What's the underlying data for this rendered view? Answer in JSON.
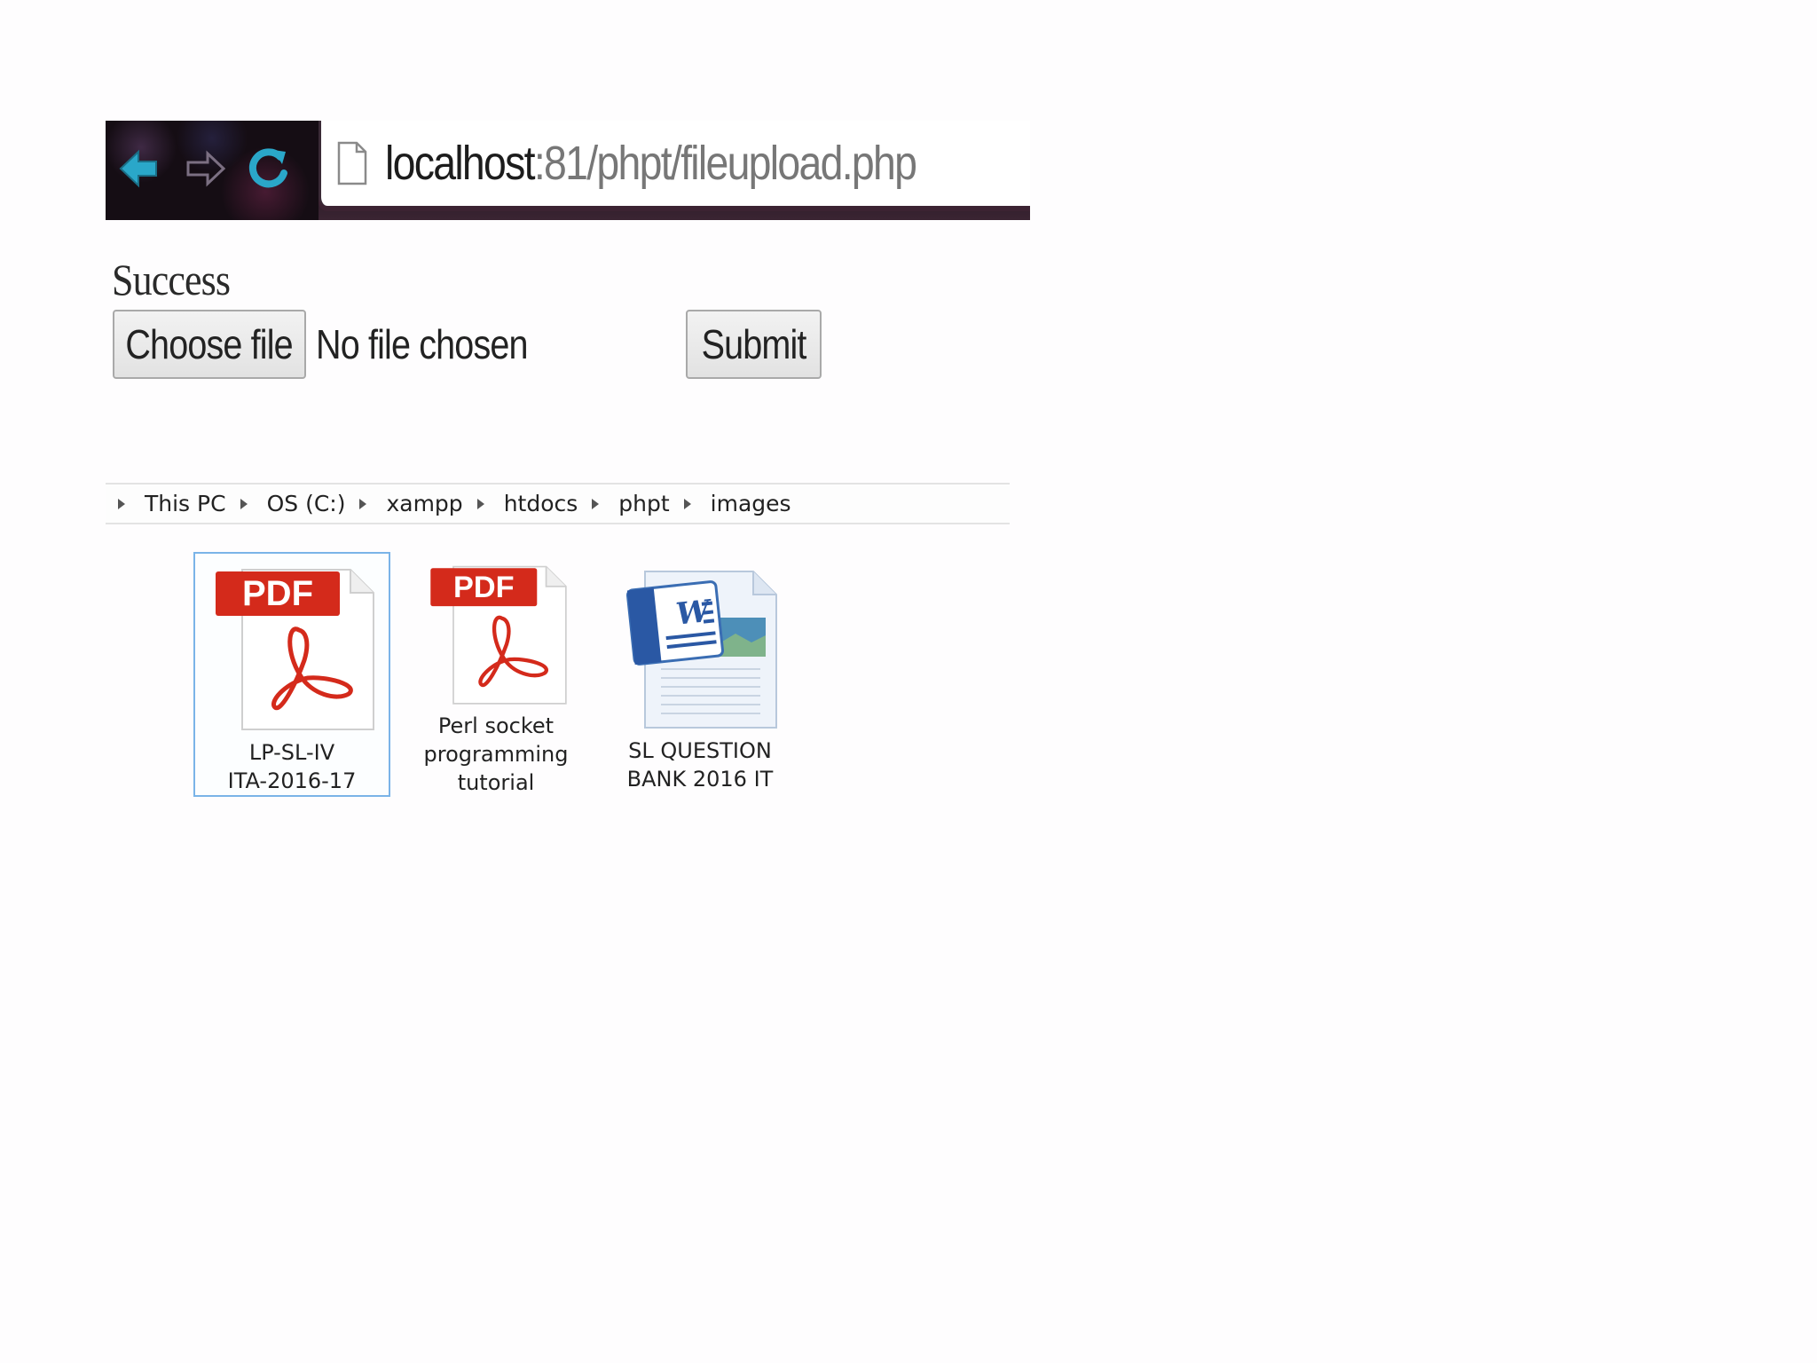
{
  "browser": {
    "url_host": "localhost",
    "url_path": ":81/phpt/fileupload.php",
    "icons": [
      "back-arrow-icon",
      "forward-arrow-icon",
      "reload-icon",
      "page-icon"
    ],
    "accent": "#2aa7c9"
  },
  "form": {
    "status": "Success",
    "choose_label": "Choose file",
    "no_file": "No file chosen",
    "submit_label": "Submit"
  },
  "explorer": {
    "breadcrumb": [
      "This PC",
      "OS (C:)",
      "xampp",
      "htdocs",
      "phpt",
      "images"
    ],
    "files": [
      {
        "line1": "LP-SL-IV",
        "line2": "ITA-2016-17",
        "line3": "",
        "type": "pdf",
        "selected": true
      },
      {
        "line1": "Perl socket",
        "line2": "programming",
        "line3": "tutorial",
        "type": "pdf",
        "selected": false
      },
      {
        "line1": "SL QUESTION",
        "line2": "BANK 2016 IT",
        "line3": "",
        "type": "docx",
        "selected": false
      }
    ],
    "selection_color": "#7ab4e8",
    "pdf_badge_color": "#d42a1b",
    "pdf_badge_label": "PDF"
  }
}
